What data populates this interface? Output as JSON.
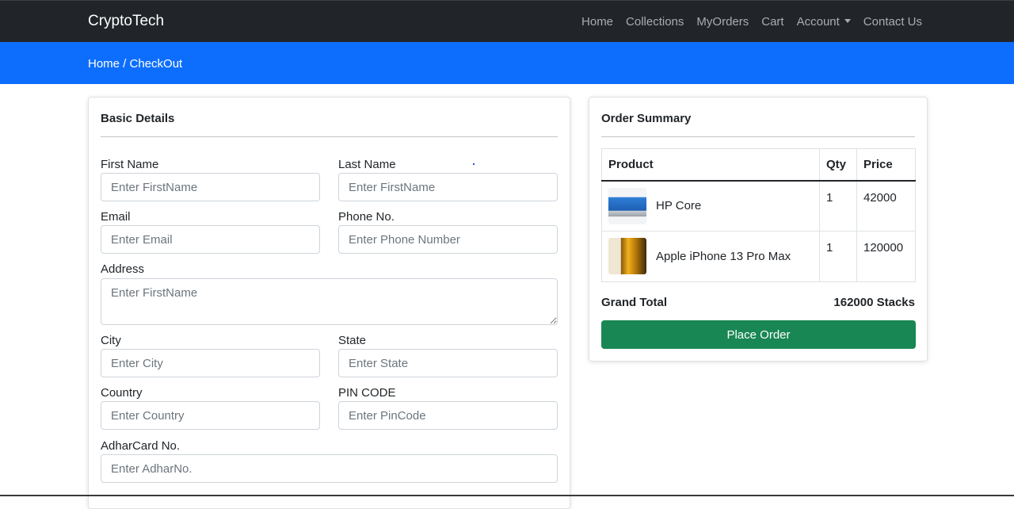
{
  "navbar": {
    "brand": "CryptoTech",
    "links": [
      "Home",
      "Collections",
      "MyOrders",
      "Cart",
      "Account",
      "Contact Us"
    ]
  },
  "breadcrumb": "Home / CheckOut",
  "basic_details": {
    "title": "Basic Details",
    "first_name": {
      "label": "First Name",
      "placeholder": "Enter FirstName",
      "value": ""
    },
    "last_name": {
      "label": "Last Name",
      "placeholder": "Enter FirstName",
      "value": ""
    },
    "email": {
      "label": "Email",
      "placeholder": "Enter Email",
      "value": ""
    },
    "phone": {
      "label": "Phone No.",
      "placeholder": "Enter Phone Number",
      "value": ""
    },
    "address": {
      "label": "Address",
      "placeholder": "Enter FirstName",
      "value": ""
    },
    "city": {
      "label": "City",
      "placeholder": "Enter City",
      "value": ""
    },
    "state": {
      "label": "State",
      "placeholder": "Enter State",
      "value": ""
    },
    "country": {
      "label": "Country",
      "placeholder": "Enter Country",
      "value": ""
    },
    "pincode": {
      "label": "PIN CODE",
      "placeholder": "Enter PinCode",
      "value": ""
    },
    "adhar": {
      "label": "AdharCard No.",
      "placeholder": "Enter AdharNo.",
      "value": ""
    }
  },
  "order_summary": {
    "title": "Order Summary",
    "columns": [
      "Product",
      "Qty",
      "Price"
    ],
    "items": [
      {
        "name": "HP Core",
        "qty": "1",
        "price": "42000",
        "image": "laptop-image"
      },
      {
        "name": "Apple iPhone 13 Pro Max",
        "qty": "1",
        "price": "120000",
        "image": "iphone-image"
      }
    ],
    "grand_total_label": "Grand Total",
    "grand_total_value": "162000 Stacks",
    "place_order_label": "Place Order"
  },
  "colors": {
    "navbar": "#212529",
    "breadcrumb_bar": "#0d6efd",
    "place_order_button": "#198754"
  }
}
